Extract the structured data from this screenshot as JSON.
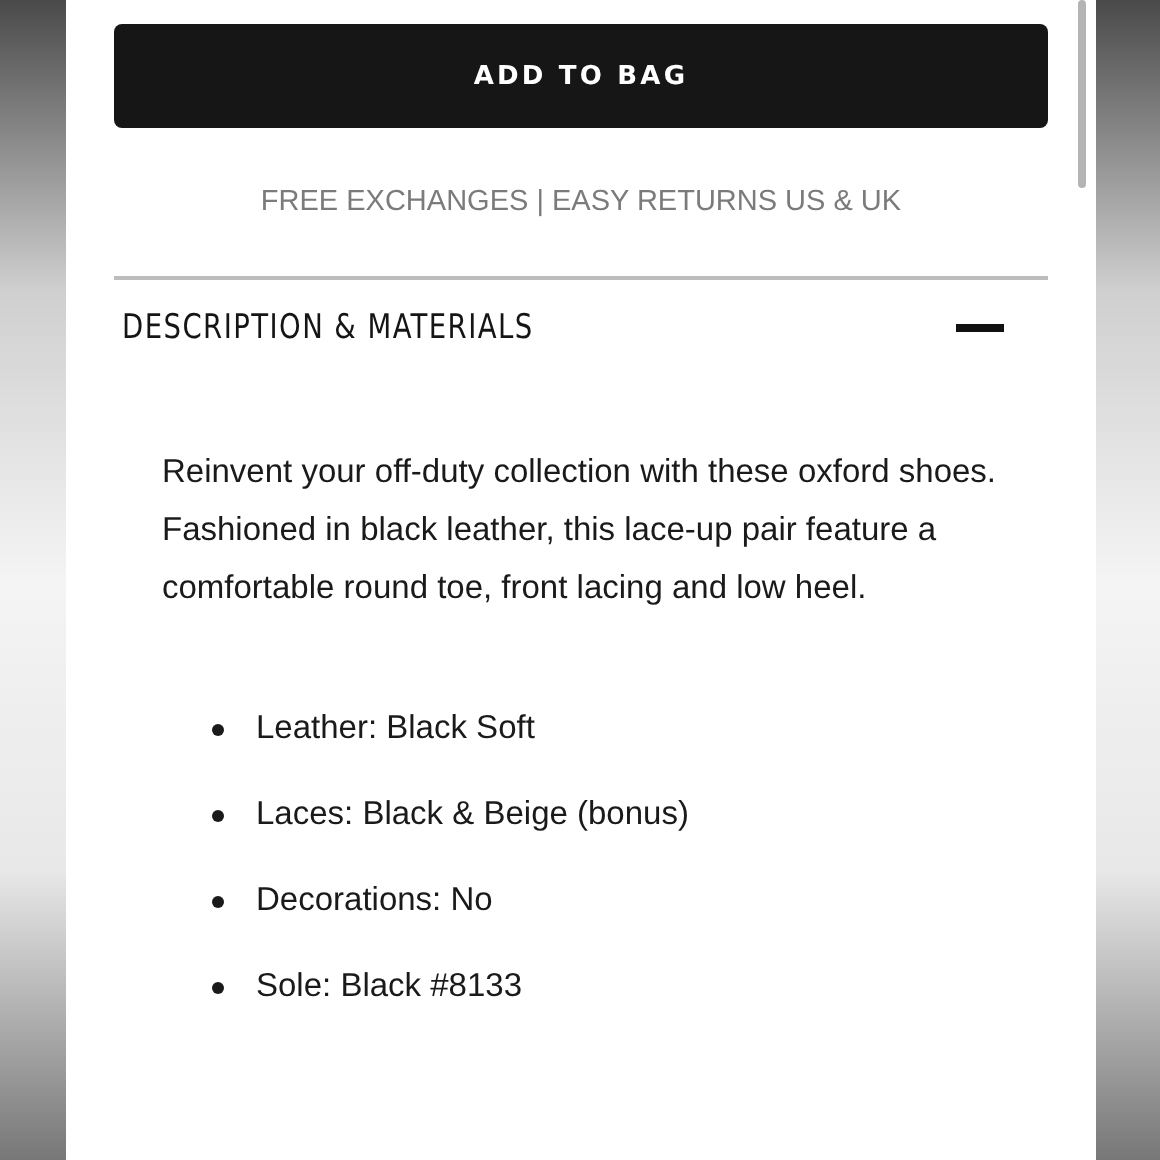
{
  "add_to_bag": {
    "label": "ADD TO BAG"
  },
  "shipping_note": "FREE EXCHANGES | EASY RETURNS US & UK",
  "accordion": {
    "title": "DESCRIPTION & MATERIALS",
    "expanded": true,
    "description": "Reinvent your off-duty collection with these oxford shoes. Fashioned in black leather, this lace-up pair feature a comfortable round toe, front lacing and low heel.",
    "details": [
      "Leather: Black Soft",
      "Laces: Black & Beige (bonus)",
      "Decorations: No",
      "Sole: Black #8133"
    ]
  }
}
